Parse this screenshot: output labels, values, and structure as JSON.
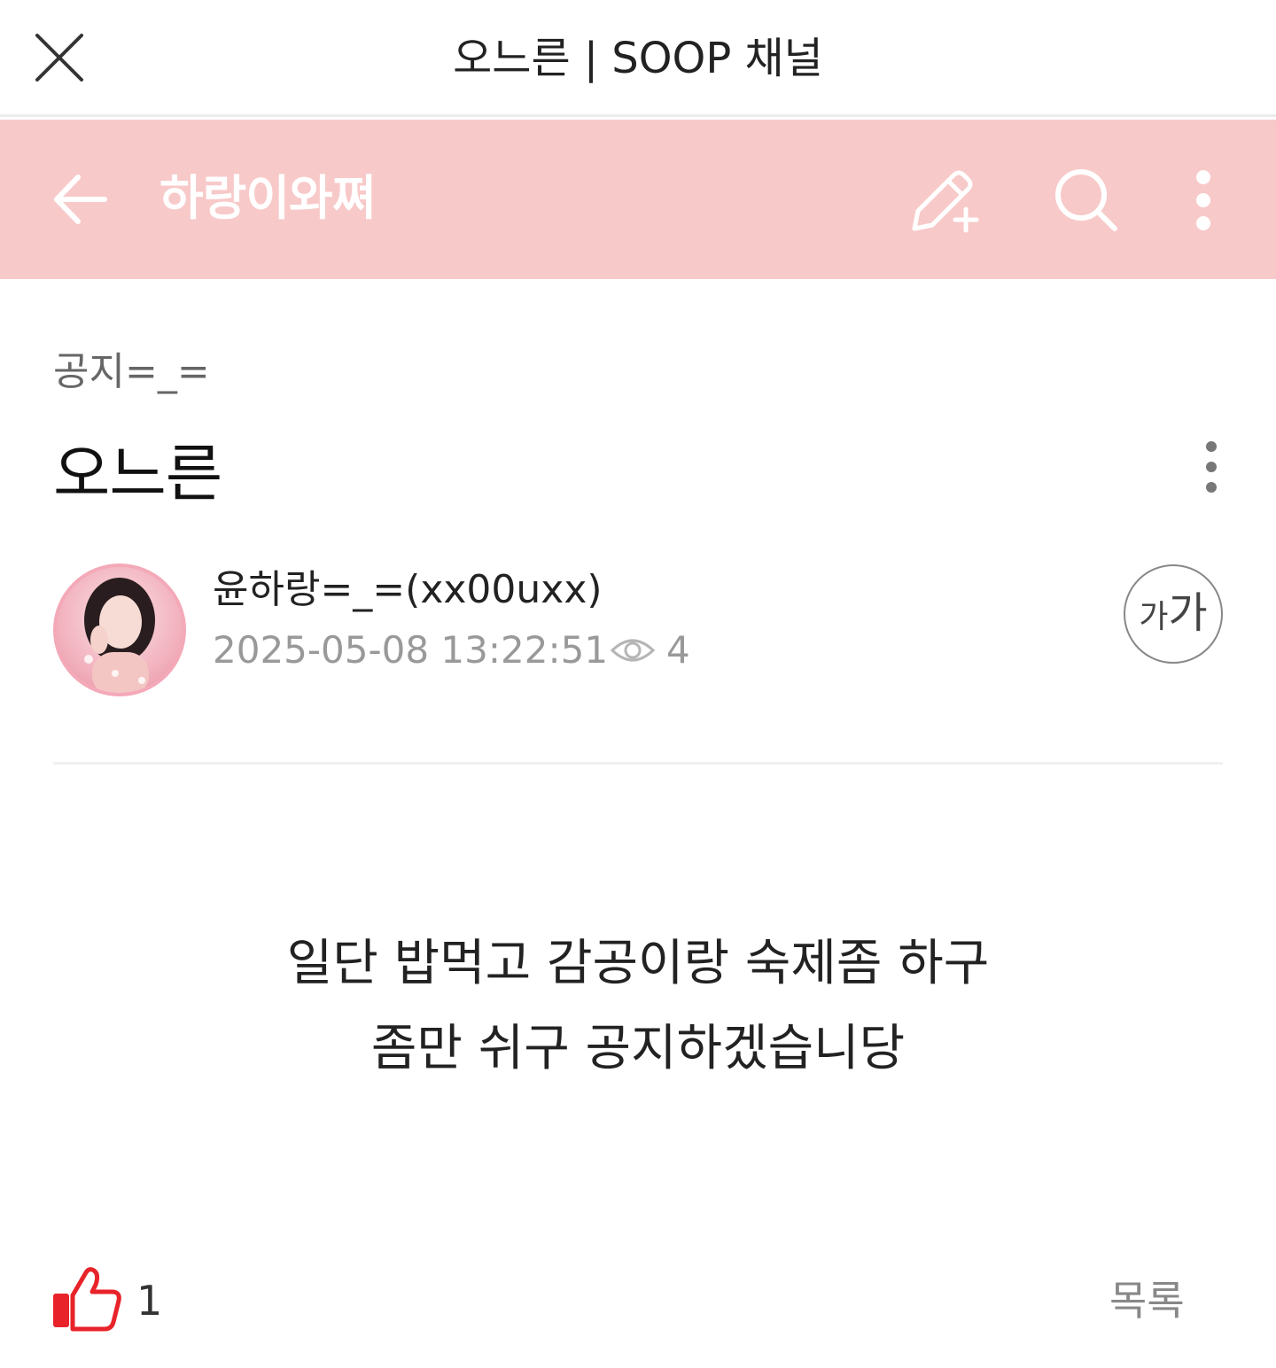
{
  "window": {
    "title": "오느른 | SOOP 채널"
  },
  "channel": {
    "name": "하랑이와쪄",
    "header_color": "#f8c9c9"
  },
  "post": {
    "category": "공지=_=",
    "title": "오느른",
    "author": "윤하랑=_=(xx00uxx)",
    "datetime": "2025-05-08 13:22:51",
    "views": "4",
    "font_button": {
      "small": "가",
      "big": "가"
    },
    "body_lines": [
      "일단 밥먹고 감공이랑 숙제좀 하구",
      "좀만 쉬구 공지하겠습니당"
    ]
  },
  "footer": {
    "like_count": "1",
    "list_label": "목록",
    "like_color": "#e8232a"
  },
  "icons": {
    "close": "close-icon",
    "back": "arrow-left-icon",
    "write": "pencil-plus-icon",
    "search": "search-icon",
    "more": "more-vertical-icon",
    "view": "eye-icon",
    "like": "thumbs-up-icon"
  }
}
